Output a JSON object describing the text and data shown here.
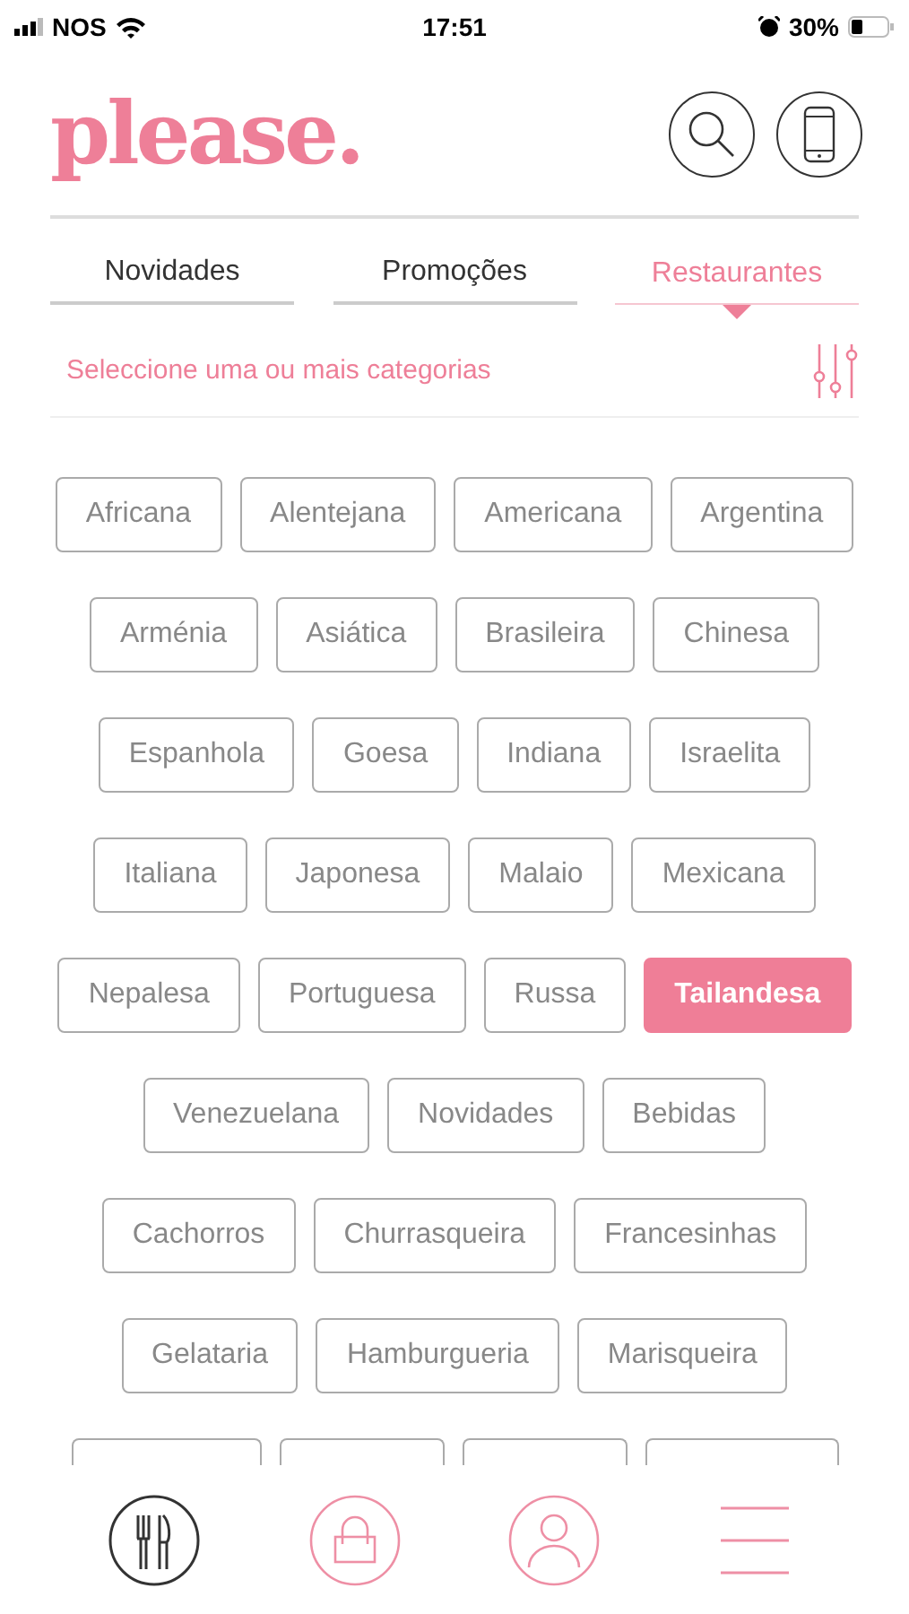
{
  "status_bar": {
    "carrier": "NOS",
    "time": "17:51",
    "battery": "30%"
  },
  "logo": "please.",
  "tabs": [
    {
      "label": "Novidades",
      "selected": false
    },
    {
      "label": "Promoções",
      "selected": false
    },
    {
      "label": "Restaurantes",
      "selected": true
    }
  ],
  "filter_prompt": "Seleccione uma ou mais categorias",
  "category_rows": [
    [
      {
        "label": "Africana",
        "selected": false
      },
      {
        "label": "Alentejana",
        "selected": false
      },
      {
        "label": "Americana",
        "selected": false
      },
      {
        "label": "Argentina",
        "selected": false
      }
    ],
    [
      {
        "label": "Arménia",
        "selected": false
      },
      {
        "label": "Asiática",
        "selected": false
      },
      {
        "label": "Brasileira",
        "selected": false
      },
      {
        "label": "Chinesa",
        "selected": false
      }
    ],
    [
      {
        "label": "Espanhola",
        "selected": false
      },
      {
        "label": "Goesa",
        "selected": false
      },
      {
        "label": "Indiana",
        "selected": false
      },
      {
        "label": "Israelita",
        "selected": false
      }
    ],
    [
      {
        "label": "Italiana",
        "selected": false
      },
      {
        "label": "Japonesa",
        "selected": false
      },
      {
        "label": "Malaio",
        "selected": false
      },
      {
        "label": "Mexicana",
        "selected": false
      }
    ],
    [
      {
        "label": "Nepalesa",
        "selected": false
      },
      {
        "label": "Portuguesa",
        "selected": false
      },
      {
        "label": "Russa",
        "selected": false
      },
      {
        "label": "Tailandesa",
        "selected": true
      }
    ],
    [
      {
        "label": "Venezuelana",
        "selected": false
      },
      {
        "label": "Novidades",
        "selected": false
      },
      {
        "label": "Bebidas",
        "selected": false
      }
    ],
    [
      {
        "label": "Cachorros",
        "selected": false
      },
      {
        "label": "Churrasqueira",
        "selected": false
      },
      {
        "label": "Francesinhas",
        "selected": false
      }
    ],
    [
      {
        "label": "Gelataria",
        "selected": false
      },
      {
        "label": "Hamburgueria",
        "selected": false
      },
      {
        "label": "Marisqueira",
        "selected": false
      }
    ]
  ],
  "bottom_nav": [
    {
      "kind": "restaurants",
      "selected": true
    },
    {
      "kind": "shopping",
      "selected": false
    },
    {
      "kind": "profile",
      "selected": false
    },
    {
      "kind": "menu",
      "selected": false
    }
  ]
}
